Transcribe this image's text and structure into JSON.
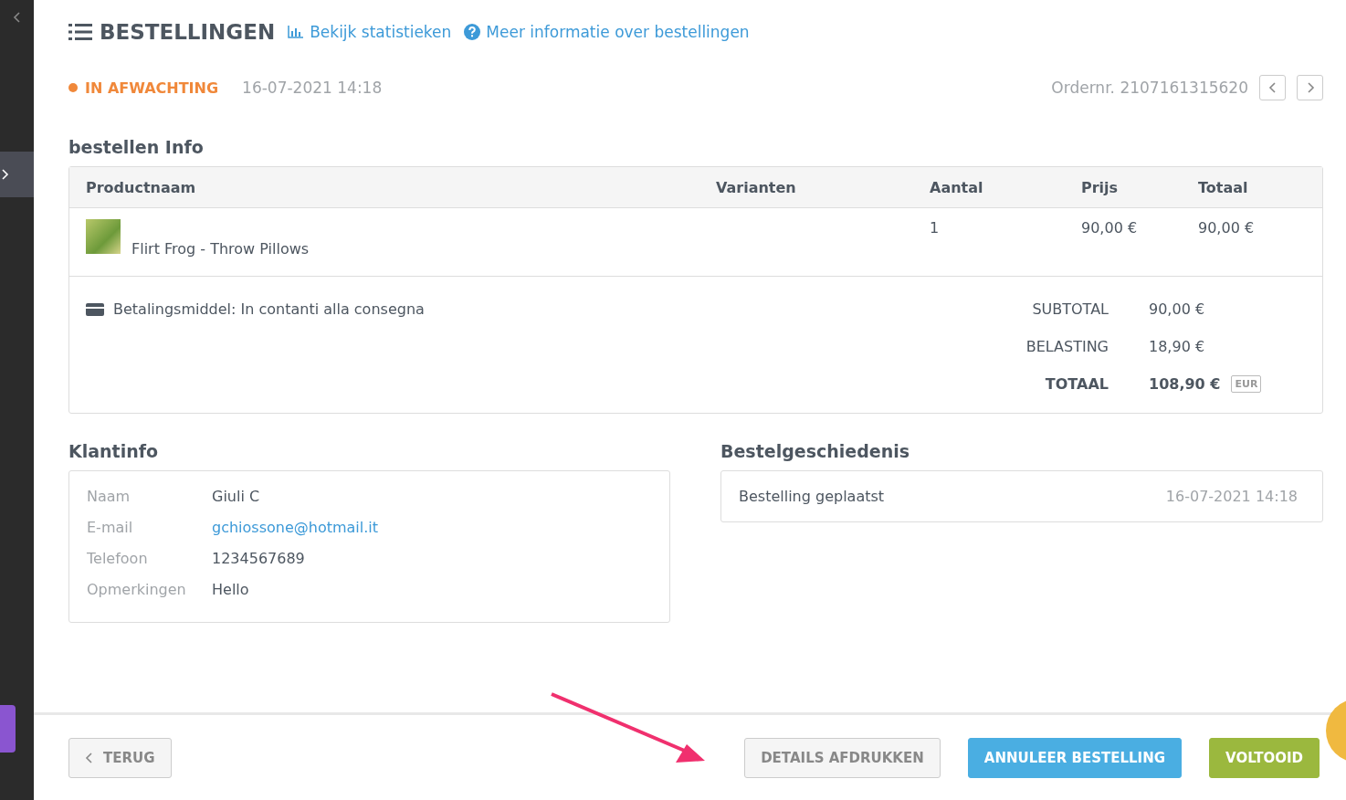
{
  "header": {
    "title": "BESTELLINGEN",
    "links": [
      {
        "kind": "stats",
        "label": "Bekijk statistieken"
      },
      {
        "kind": "help",
        "label": "Meer informatie over bestellingen"
      }
    ]
  },
  "status": {
    "label": "IN AFWACHTING",
    "color": "#f0883a",
    "date": "16-07-2021 14:18",
    "order_number": "Ordernr. 2107161315620"
  },
  "order_info": {
    "title": "bestellen Info",
    "columns": [
      "Productnaam",
      "Varianten",
      "Aantal",
      "Prijs",
      "Totaal"
    ],
    "rows": [
      {
        "product": "Flirt Frog - Throw Pillows",
        "variants": "",
        "quantity": "1",
        "price": "90,00 €",
        "total": "90,00 €"
      }
    ],
    "payment": "Betalingsmiddel: In contanti alla consegna",
    "totals": [
      {
        "kind": "normal",
        "label": "SUBTOTAL",
        "value": "90,00 €"
      },
      {
        "kind": "normal",
        "label": "BELASTING",
        "value": "18,90 €"
      },
      {
        "kind": "grand",
        "label": "TOTAAL",
        "value": "108,90 €",
        "currency": "EUR"
      }
    ]
  },
  "customer": {
    "title": "Klantinfo",
    "fields": [
      {
        "kind": "text",
        "label": "Naam",
        "value": "Giuli C"
      },
      {
        "kind": "link",
        "label": "E-mail",
        "value": "gchiossone@hotmail.it"
      },
      {
        "kind": "text",
        "label": "Telefoon",
        "value": "1234567689"
      },
      {
        "kind": "text",
        "label": "Opmerkingen",
        "value": "Hello"
      }
    ]
  },
  "history": {
    "title": "Bestelgeschiedenis",
    "entries": [
      {
        "event": "Bestelling geplaatst",
        "date": "16-07-2021 14:18"
      }
    ]
  },
  "footer": {
    "buttons": [
      {
        "kind": "back",
        "label": "TERUG"
      },
      {
        "kind": "default",
        "label": "DETAILS AFDRUKKEN"
      },
      {
        "kind": "info",
        "label": "ANNULEER BESTELLING"
      },
      {
        "kind": "success",
        "label": "VOLTOOID"
      }
    ]
  }
}
